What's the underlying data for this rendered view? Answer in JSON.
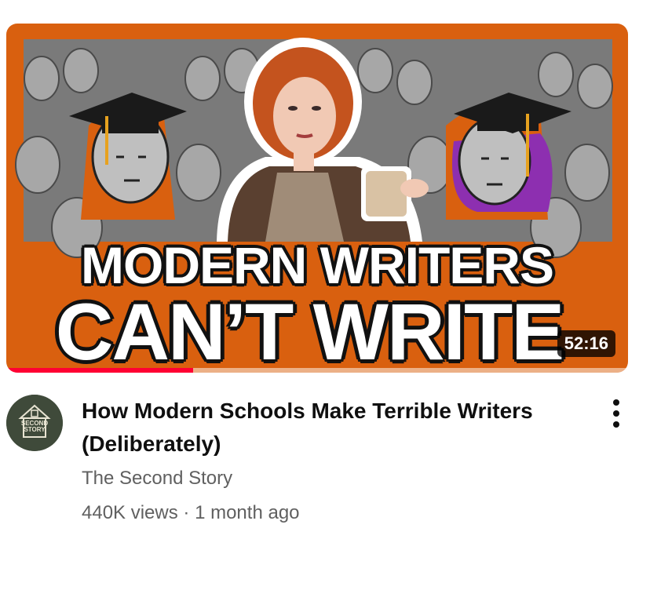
{
  "thumbnail": {
    "line1": "MODERN WRITERS",
    "line2": "CAN’T WRITE",
    "duration": "52:16",
    "progress_fraction": 0.3,
    "border_color": "#d9600f",
    "progress_color": "#ff0033"
  },
  "video": {
    "title": "How Modern Schools Make Terrible Writers (Deliberately)",
    "channel": "The Second Story",
    "views": "440K views",
    "separator": "·",
    "age": "1 month ago"
  },
  "channel_avatar": {
    "text_line1": "SECOND",
    "text_line2": "STORY"
  },
  "menu": {
    "icon": "more-vert-icon"
  }
}
